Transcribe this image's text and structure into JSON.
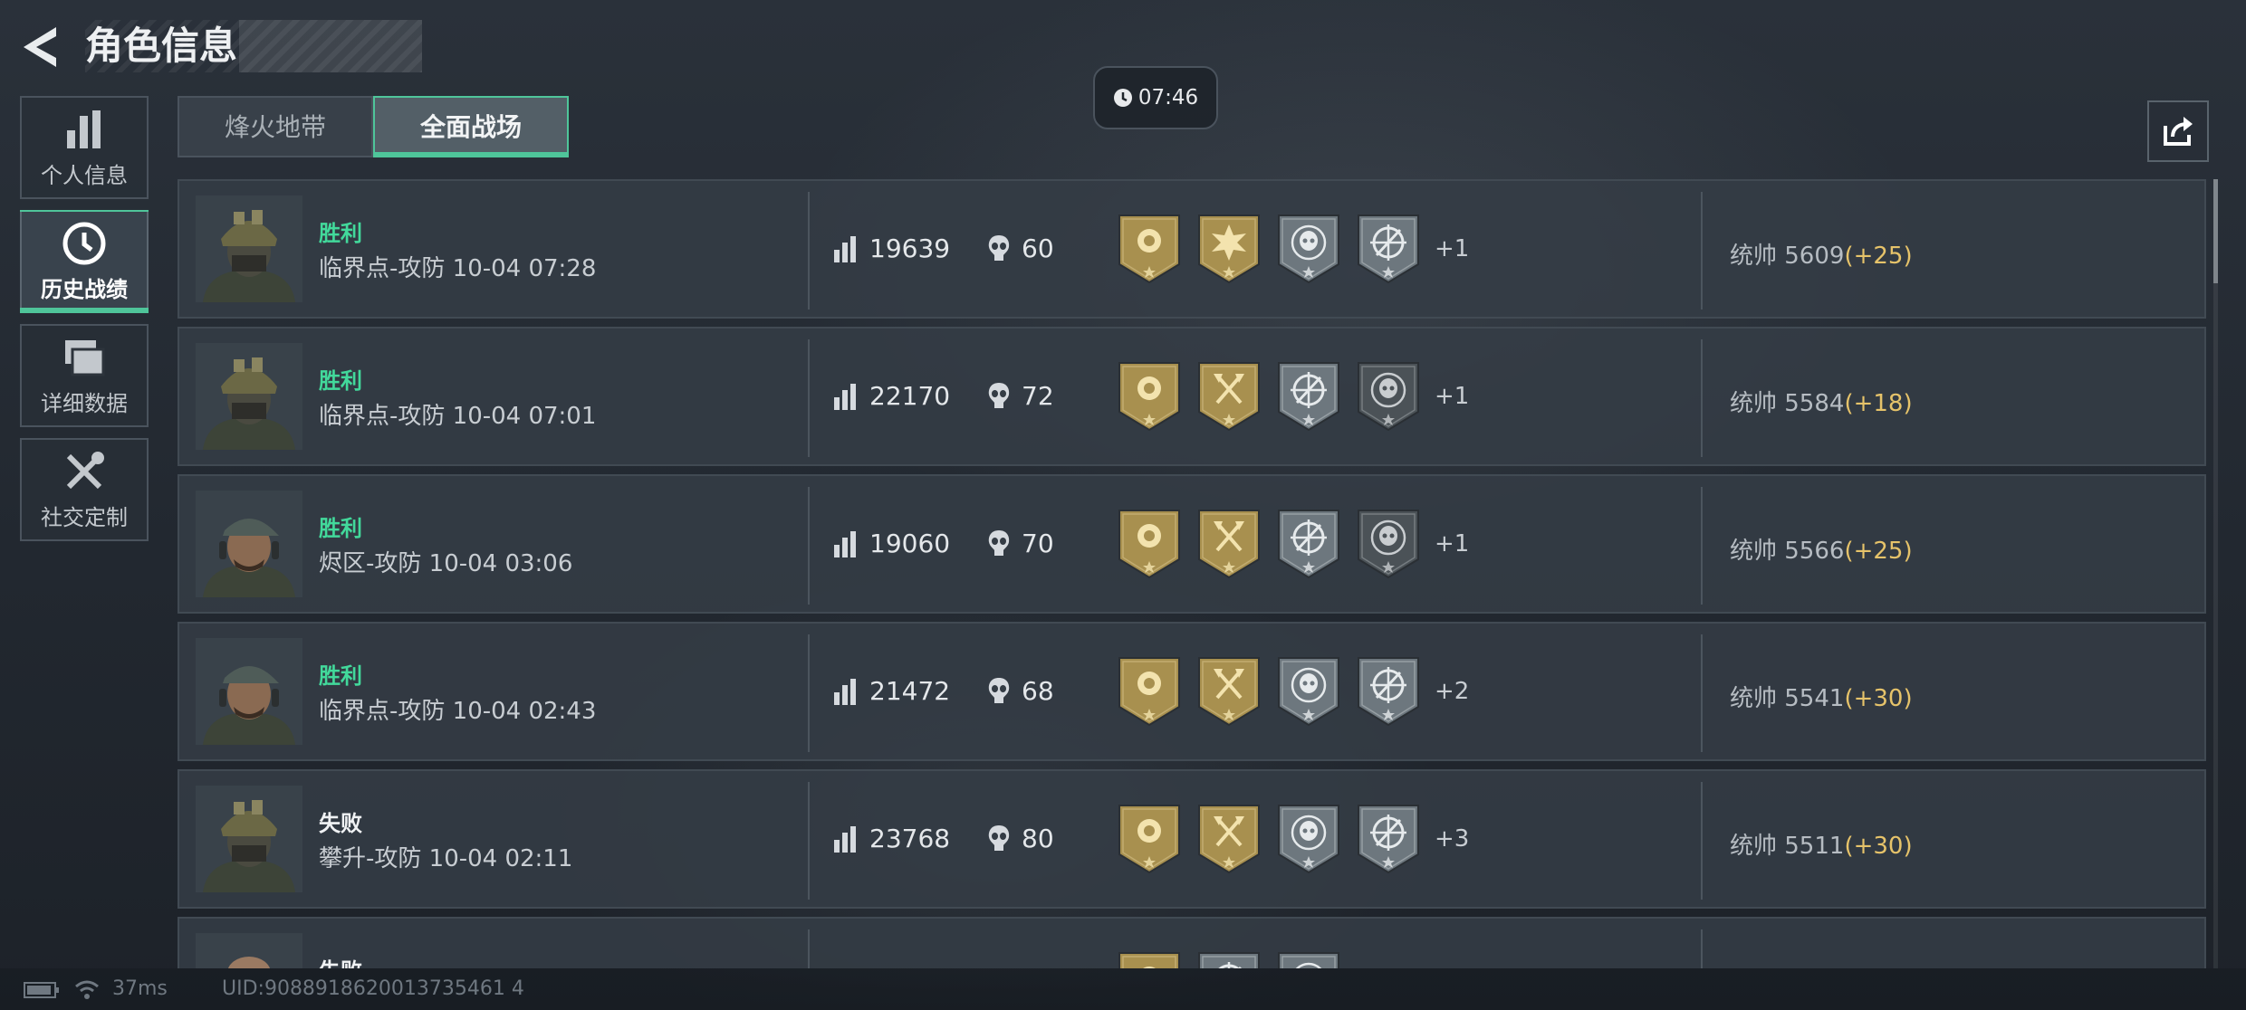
{
  "header": {
    "title": "角色信息"
  },
  "side_nav": [
    {
      "label": "个人信息",
      "icon": "bar-chart-icon",
      "active": false
    },
    {
      "label": "历史战绩",
      "icon": "history-clock-icon",
      "active": true
    },
    {
      "label": "详细数据",
      "icon": "data-folder-icon",
      "active": false
    },
    {
      "label": "社交定制",
      "icon": "tools-icon",
      "active": false
    }
  ],
  "tabs": [
    {
      "label": "烽火地带",
      "active": false
    },
    {
      "label": "全面战场",
      "active": true
    }
  ],
  "clock": {
    "time": "07:46"
  },
  "matches": [
    {
      "result": "胜利",
      "win": true,
      "map_time": "临界点-攻防 10-04 07:28",
      "score": "19639",
      "kills": "60",
      "medals": [
        "gold-rose",
        "gold-burst",
        "silver-skull",
        "silver-crosshair"
      ],
      "extra": "+1",
      "rating_label": "统帅 5609",
      "rating_delta": "(+25)",
      "portrait": "helmet"
    },
    {
      "result": "胜利",
      "win": true,
      "map_time": "临界点-攻防 10-04 07:01",
      "score": "22170",
      "kills": "72",
      "medals": [
        "gold-rose",
        "gold-axes",
        "silver-crosshair",
        "dark-skull"
      ],
      "extra": "+1",
      "rating_label": "统帅 5584",
      "rating_delta": "(+18)",
      "portrait": "helmet"
    },
    {
      "result": "胜利",
      "win": true,
      "map_time": "烬区-攻防 10-04 03:06",
      "score": "19060",
      "kills": "70",
      "medals": [
        "gold-rose",
        "gold-axes",
        "silver-crosshair",
        "dark-skull"
      ],
      "extra": "+1",
      "rating_label": "统帅 5566",
      "rating_delta": "(+25)",
      "portrait": "cap"
    },
    {
      "result": "胜利",
      "win": true,
      "map_time": "临界点-攻防 10-04 02:43",
      "score": "21472",
      "kills": "68",
      "medals": [
        "gold-rose",
        "gold-axes",
        "silver-skull",
        "silver-crosshair"
      ],
      "extra": "+2",
      "rating_label": "统帅 5541",
      "rating_delta": "(+30)",
      "portrait": "cap"
    },
    {
      "result": "失败",
      "win": false,
      "map_time": "攀升-攻防 10-04 02:11",
      "score": "23768",
      "kills": "80",
      "medals": [
        "gold-rose",
        "gold-axes",
        "silver-skull",
        "silver-crosshair"
      ],
      "extra": "+3",
      "rating_label": "统帅 5511",
      "rating_delta": "(+30)",
      "portrait": "helmet"
    },
    {
      "result": "失败",
      "win": false,
      "map_time": "",
      "score": "",
      "kills": "",
      "medals": [
        "gold-rose",
        "silver-crosshair",
        "silver-skull"
      ],
      "extra": "",
      "rating_label": "",
      "rating_delta": "",
      "portrait": "bald"
    }
  ],
  "status_bar": {
    "ping": "37ms",
    "uid": "UID:9088918620013735461 4"
  },
  "colors": {
    "accent": "#4fc59a",
    "win": "#42d99b",
    "delta": "#e6c36a",
    "gold_medal": "#a8904f",
    "silver_medal": "#6d777e"
  }
}
